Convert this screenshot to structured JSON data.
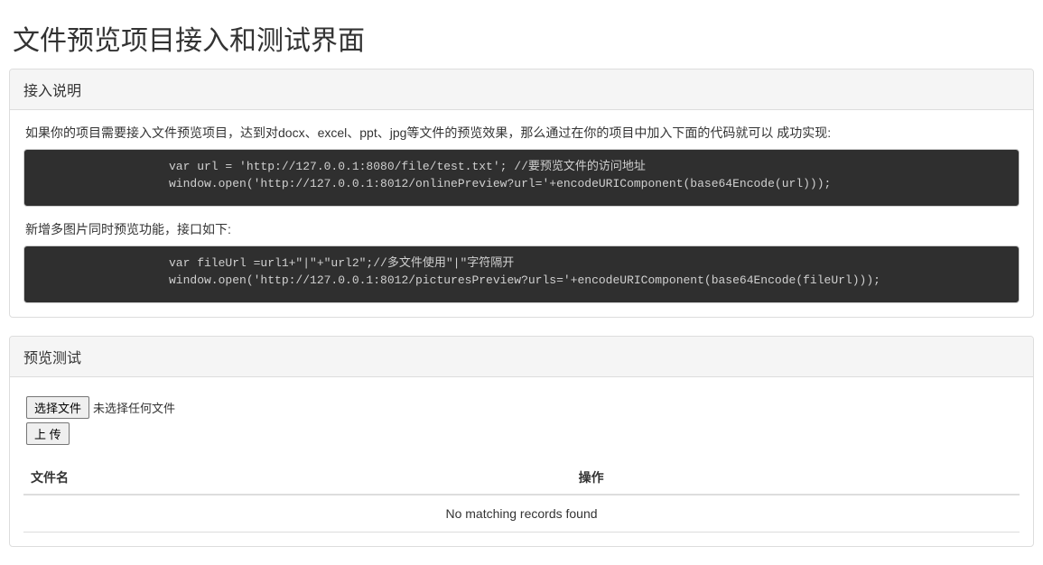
{
  "page": {
    "title": "文件预览项目接入和测试界面"
  },
  "panel1": {
    "heading": "接入说明",
    "intro_text_1": "如果你的项目需要接入文件预览项目，达到对docx、excel、ppt、jpg等文件的预览效果，那么通过在你的项目中加入下面的代码就可以 成功实现:",
    "code_block_1": "var url = 'http://127.0.0.1:8080/file/test.txt'; //要预览文件的访问地址\nwindow.open('http://127.0.0.1:8012/onlinePreview?url='+encodeURIComponent(base64Encode(url)));",
    "intro_text_2": "新增多图片同时预览功能，接口如下:",
    "code_block_2": "var fileUrl =url1+\"|\"+\"url2\";//多文件使用\"|\"字符隔开\nwindow.open('http://127.0.0.1:8012/picturesPreview?urls='+encodeURIComponent(base64Encode(fileUrl)));"
  },
  "panel2": {
    "heading": "预览测试",
    "file_choose_label": "选择文件",
    "file_status": "未选择任何文件",
    "upload_label": "上 传",
    "table": {
      "col1": "文件名",
      "col2": "操作",
      "empty_message": "No matching records found"
    }
  }
}
